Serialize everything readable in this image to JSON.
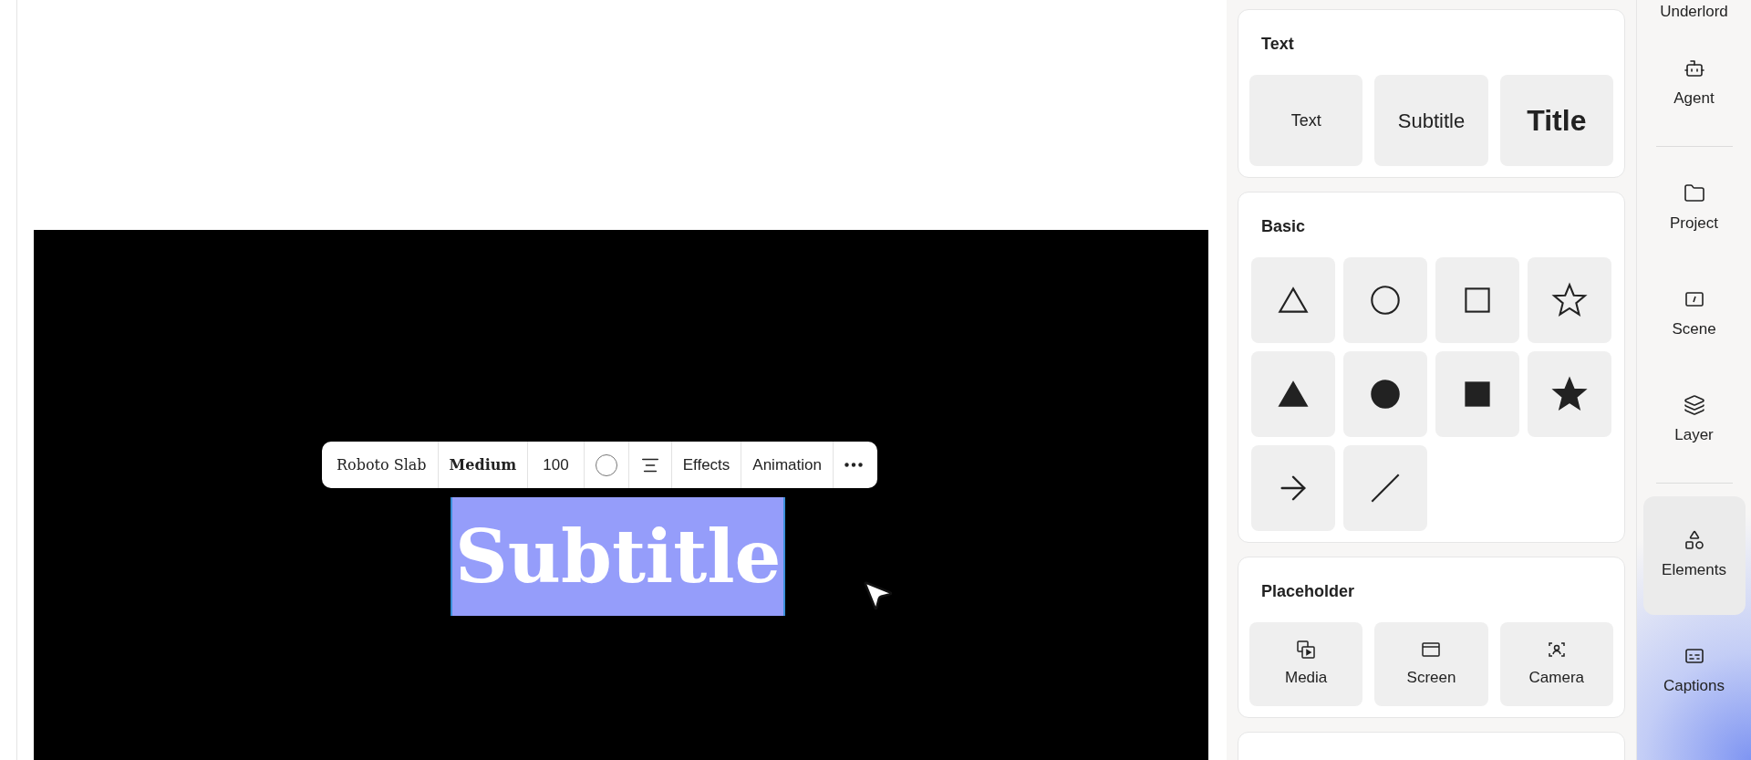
{
  "text_toolbar": {
    "items": [
      {
        "kind": "font",
        "label": "Roboto Slab"
      },
      {
        "kind": "weight",
        "label": "Medium"
      },
      {
        "kind": "size",
        "label": "100"
      },
      {
        "kind": "color"
      },
      {
        "kind": "align"
      },
      {
        "kind": "text",
        "label": "Effects"
      },
      {
        "kind": "text",
        "label": "Animation"
      },
      {
        "kind": "more"
      }
    ]
  },
  "canvas": {
    "selected_text": "Subtitle"
  },
  "elements_panel": {
    "sections": [
      {
        "title": "Text",
        "kind": "text",
        "items": [
          {
            "label": "Text",
            "kind": "small"
          },
          {
            "label": "Subtitle",
            "kind": "medium"
          },
          {
            "label": "Title",
            "kind": "large"
          }
        ]
      },
      {
        "title": "Basic",
        "kind": "shapes",
        "items": [
          {
            "kind": "triangle"
          },
          {
            "kind": "circle"
          },
          {
            "kind": "square"
          },
          {
            "kind": "star"
          },
          {
            "kind": "triangle-filled"
          },
          {
            "kind": "circle-filled"
          },
          {
            "kind": "square-filled"
          },
          {
            "kind": "star-filled"
          },
          {
            "kind": "arrow"
          },
          {
            "kind": "line"
          }
        ]
      },
      {
        "title": "Placeholder",
        "kind": "placeholders",
        "items": [
          {
            "label": "Media",
            "kind": "media"
          },
          {
            "label": "Screen",
            "kind": "screen"
          },
          {
            "label": "Camera",
            "kind": "camera"
          }
        ]
      }
    ]
  },
  "sidebar": {
    "items": [
      {
        "label": "Underlord",
        "kind": "none",
        "selected": false
      },
      {
        "label": "Agent",
        "kind": "robot",
        "selected": false
      },
      {
        "label": "Project",
        "kind": "folder",
        "selected": false
      },
      {
        "label": "Scene",
        "kind": "scene",
        "selected": false
      },
      {
        "label": "Layer",
        "kind": "layers",
        "selected": false
      },
      {
        "label": "Elements",
        "kind": "elements",
        "selected": true
      },
      {
        "label": "Captions",
        "kind": "captions",
        "selected": false
      }
    ]
  }
}
